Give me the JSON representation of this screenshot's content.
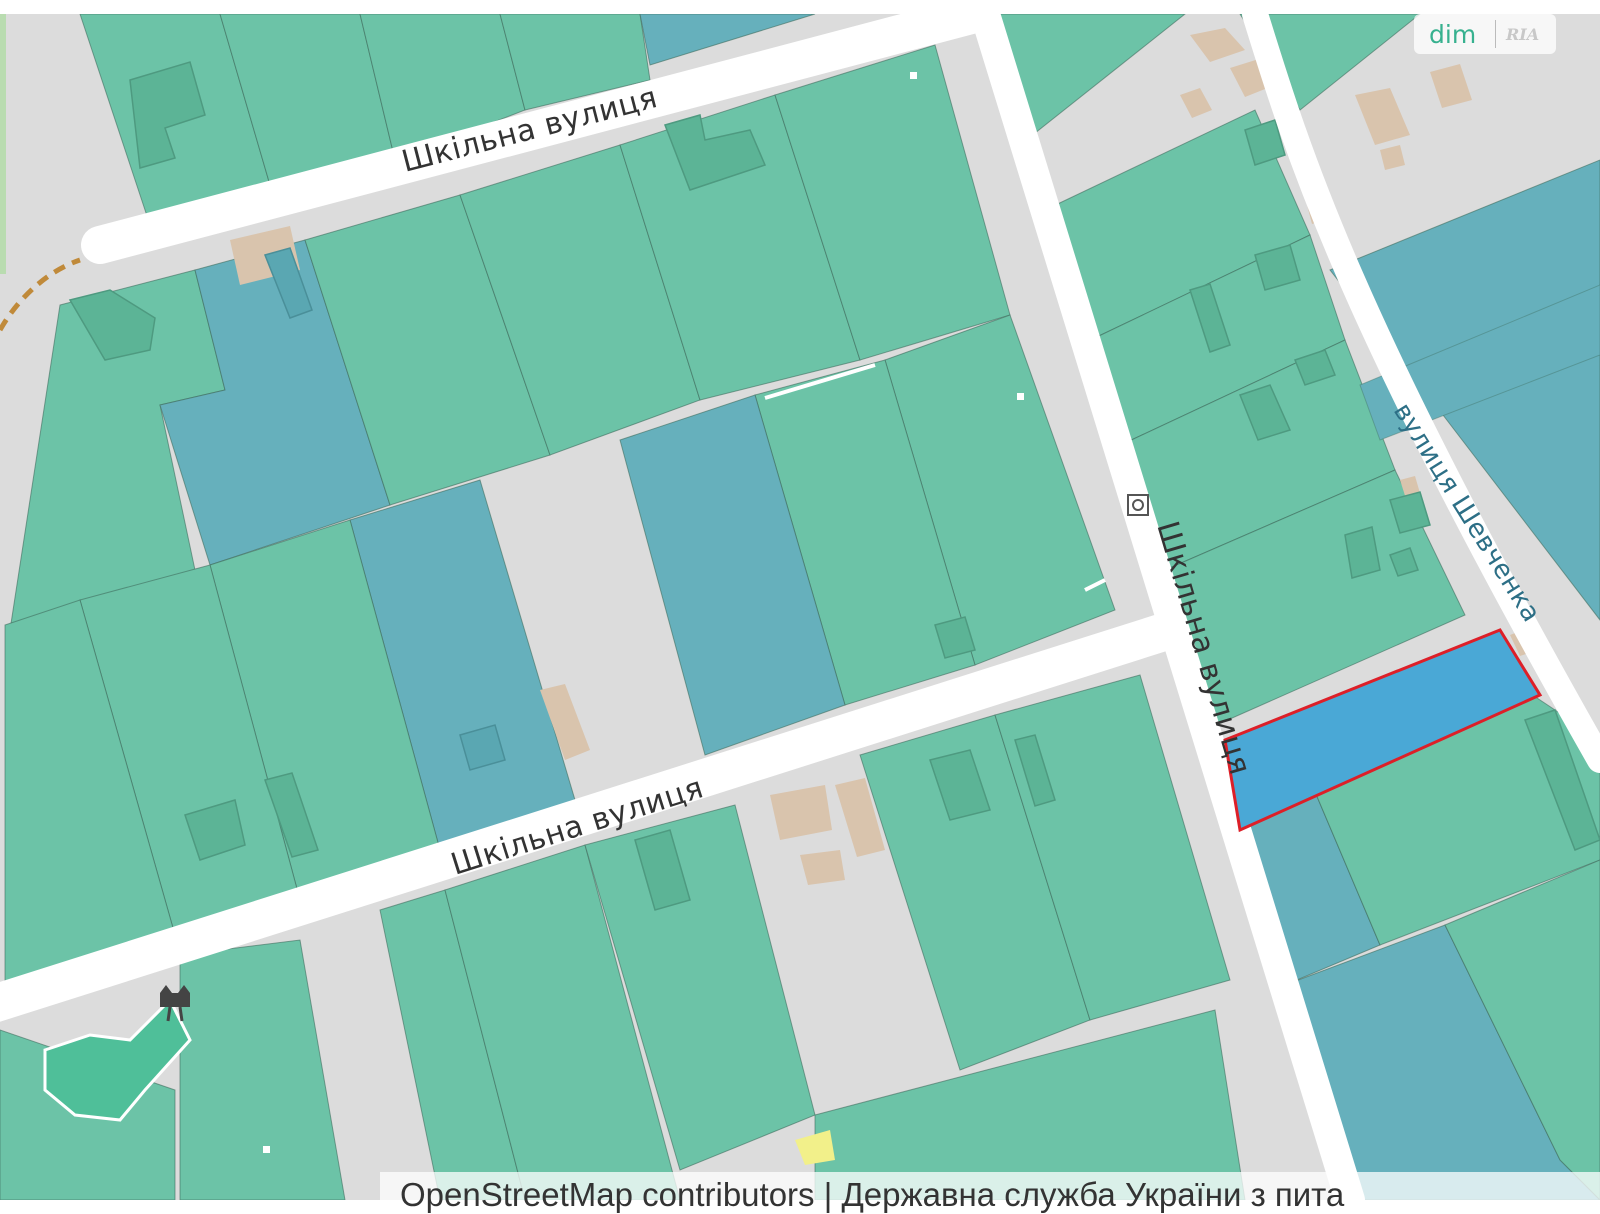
{
  "map": {
    "street_labels": {
      "shkilna_north": "Шкільна вулиця",
      "shkilna_south": "Шкільна вулиця",
      "shkilna_vertical": "Шкільна вулиця",
      "shevchenka": "вулиця Шевченка"
    },
    "colors": {
      "road": "#ffffff",
      "background": "#dcdcdc",
      "parcel_green": "#6cc3a7",
      "parcel_blue": "#66b0bc",
      "highlight_fill": "#4aa8d6",
      "highlight_stroke": "#dd1f28",
      "building": "#d9c4ad"
    }
  },
  "watermark": {
    "brand": "dim",
    "partner": "RIA"
  },
  "attribution": {
    "text": "OpenStreetMap contributors | Державна служба України з пита"
  }
}
